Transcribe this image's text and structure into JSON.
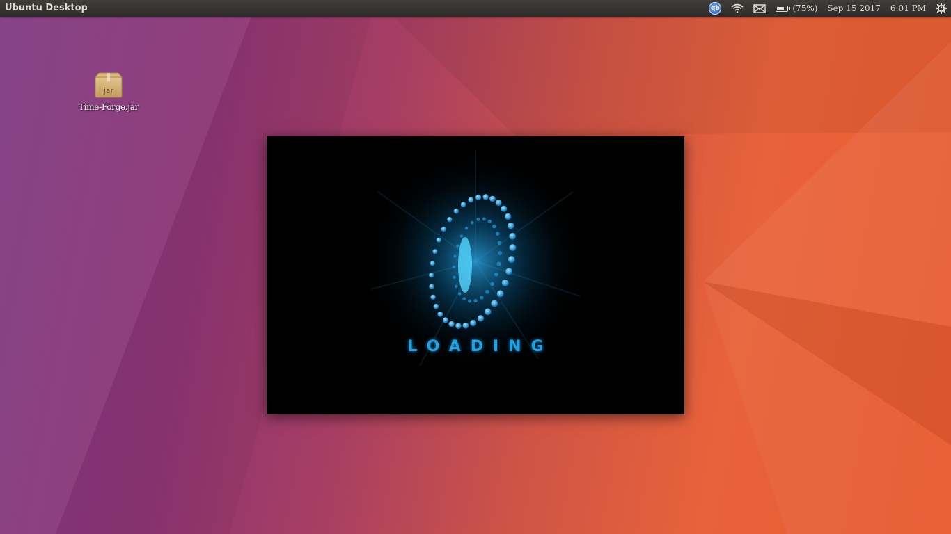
{
  "panel": {
    "title": "Ubuntu Desktop",
    "indicators": {
      "qbittorrent_icon": "qb",
      "battery_text": "(75%)",
      "battery_level_percent": 75,
      "date": "Sep 15 2017",
      "time": "6:01 PM"
    }
  },
  "desktop": {
    "icons": [
      {
        "label": "Time-Forge.jar",
        "badge": "jar",
        "icon": "archive-box-icon"
      }
    ]
  },
  "splash": {
    "loading_text": "LOADING"
  },
  "colors": {
    "panel_bg": "#3c3b37",
    "panel_text": "#dfdbd2",
    "accent_blue": "#1ea3e6",
    "wallpaper_left": "#7f3a82",
    "wallpaper_right": "#e85a2e"
  }
}
